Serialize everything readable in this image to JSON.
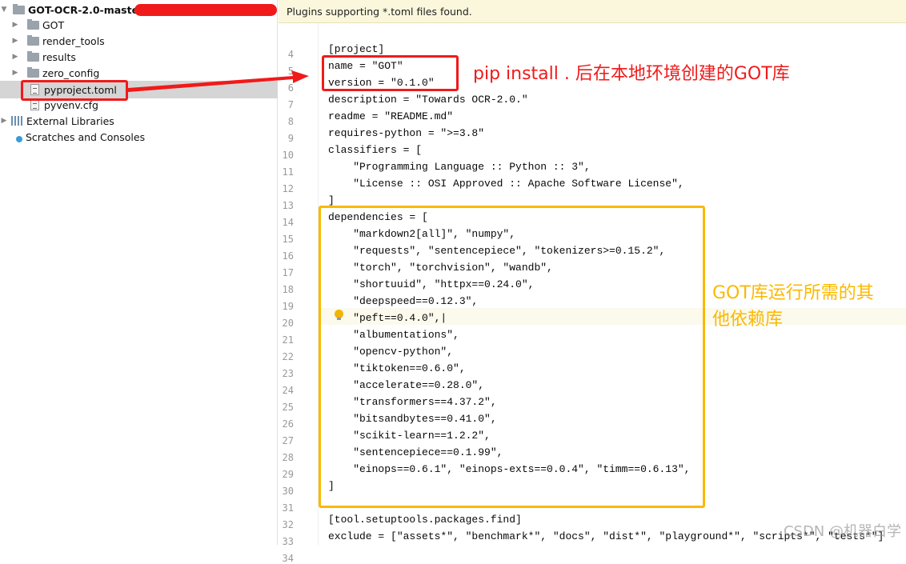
{
  "sidebar": {
    "root": "GOT-OCR-2.0-master",
    "items": [
      {
        "label": "GOT",
        "icon": "package-folder-icon"
      },
      {
        "label": "render_tools",
        "icon": "folder-icon"
      },
      {
        "label": "results",
        "icon": "folder-icon"
      },
      {
        "label": "zero_config",
        "icon": "folder-icon"
      },
      {
        "label": "pyproject.toml",
        "icon": "file-icon",
        "selected": true
      },
      {
        "label": "pyvenv.cfg",
        "icon": "file-icon"
      },
      {
        "label": "External Libraries",
        "icon": "libraries-icon"
      },
      {
        "label": "Scratches and Consoles",
        "icon": "scratches-icon"
      }
    ]
  },
  "editor": {
    "banner": "Plugins supporting *.toml files found.",
    "current_line": 21,
    "lines": [
      {
        "n": "4",
        "t": ""
      },
      {
        "n": "5",
        "t": "[project]"
      },
      {
        "n": "6",
        "t": "name = \"GOT\""
      },
      {
        "n": "7",
        "t": "version = \"0.1.0\""
      },
      {
        "n": "8",
        "t": "description = \"Towards OCR-2.0.\""
      },
      {
        "n": "9",
        "t": "readme = \"README.md\""
      },
      {
        "n": "10",
        "t": "requires-python = \">=3.8\""
      },
      {
        "n": "11",
        "t": "classifiers = ["
      },
      {
        "n": "12",
        "t": "    \"Programming Language :: Python :: 3\","
      },
      {
        "n": "13",
        "t": "    \"License :: OSI Approved :: Apache Software License\","
      },
      {
        "n": "14",
        "t": "]"
      },
      {
        "n": "15",
        "t": "dependencies = ["
      },
      {
        "n": "16",
        "t": "    \"markdown2[all]\", \"numpy\","
      },
      {
        "n": "17",
        "t": "    \"requests\", \"sentencepiece\", \"tokenizers>=0.15.2\","
      },
      {
        "n": "18",
        "t": "    \"torch\", \"torchvision\", \"wandb\","
      },
      {
        "n": "19",
        "t": "    \"shortuuid\", \"httpx==0.24.0\","
      },
      {
        "n": "20",
        "t": "    \"deepspeed==0.12.3\","
      },
      {
        "n": "21",
        "t": "    \"peft==0.4.0\",|"
      },
      {
        "n": "22",
        "t": "    \"albumentations\","
      },
      {
        "n": "23",
        "t": "    \"opencv-python\","
      },
      {
        "n": "24",
        "t": "    \"tiktoken==0.6.0\","
      },
      {
        "n": "25",
        "t": "    \"accelerate==0.28.0\","
      },
      {
        "n": "26",
        "t": "    \"transformers==4.37.2\","
      },
      {
        "n": "27",
        "t": "    \"bitsandbytes==0.41.0\","
      },
      {
        "n": "28",
        "t": "    \"scikit-learn==1.2.2\","
      },
      {
        "n": "29",
        "t": "    \"sentencepiece==0.1.99\","
      },
      {
        "n": "30",
        "t": "    \"einops==0.6.1\", \"einops-exts==0.0.4\", \"timm==0.6.13\","
      },
      {
        "n": "31",
        "t": "]"
      },
      {
        "n": "32",
        "t": ""
      },
      {
        "n": "33",
        "t": "[tool.setuptools.packages.find]"
      },
      {
        "n": "34",
        "t": "exclude = [\"assets*\", \"benchmark*\", \"docs\", \"dist*\", \"playground*\", \"scripts*\", \"tests*\"]"
      }
    ]
  },
  "annotations": {
    "red_note": "pip install . 后在本地环境创建的GOT库",
    "yellow_note_1": "GOT库运行所需的其",
    "yellow_note_2": "他依赖库",
    "red": "#f01a1a",
    "yellow": "#fbb800"
  },
  "watermark": "CSDN @机器白学"
}
